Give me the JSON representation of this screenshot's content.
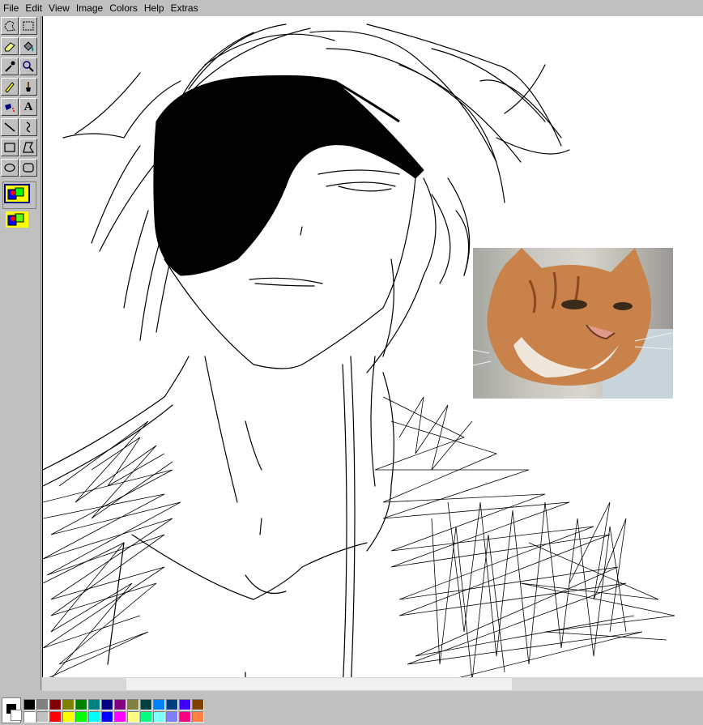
{
  "menu": [
    {
      "label": "File"
    },
    {
      "label": "Edit"
    },
    {
      "label": "View"
    },
    {
      "label": "Image"
    },
    {
      "label": "Colors"
    },
    {
      "label": "Help"
    },
    {
      "label": "Extras"
    }
  ],
  "tools": [
    {
      "name": "free-select-icon"
    },
    {
      "name": "rect-select-icon"
    },
    {
      "name": "eraser-icon"
    },
    {
      "name": "fill-bucket-icon"
    },
    {
      "name": "color-picker-icon"
    },
    {
      "name": "magnifier-icon"
    },
    {
      "name": "pencil-icon"
    },
    {
      "name": "brush-icon"
    },
    {
      "name": "airbrush-icon"
    },
    {
      "name": "text-icon",
      "glyph": "A"
    },
    {
      "name": "line-icon"
    },
    {
      "name": "curve-icon"
    },
    {
      "name": "rectangle-icon"
    },
    {
      "name": "polygon-icon"
    },
    {
      "name": "ellipse-icon"
    },
    {
      "name": "rounded-rect-icon"
    }
  ],
  "palette": {
    "foreground": "#000000",
    "background": "#ffffff",
    "colors_row1": [
      "#000000",
      "#808080",
      "#800000",
      "#808000",
      "#008000",
      "#008080",
      "#000080",
      "#800080",
      "#808040",
      "#004040",
      "#0080ff",
      "#004080",
      "#4000ff",
      "#804000"
    ],
    "colors_row2": [
      "#ffffff",
      "#c0c0c0",
      "#ff0000",
      "#ffff00",
      "#00ff00",
      "#00ffff",
      "#0000ff",
      "#ff00ff",
      "#ffff80",
      "#00ff80",
      "#80ffff",
      "#8080ff",
      "#ff0080",
      "#ff8040"
    ]
  },
  "canvas": {
    "content": "line-art-portrait-with-eyepatch-and-pasted-cat-photo"
  }
}
